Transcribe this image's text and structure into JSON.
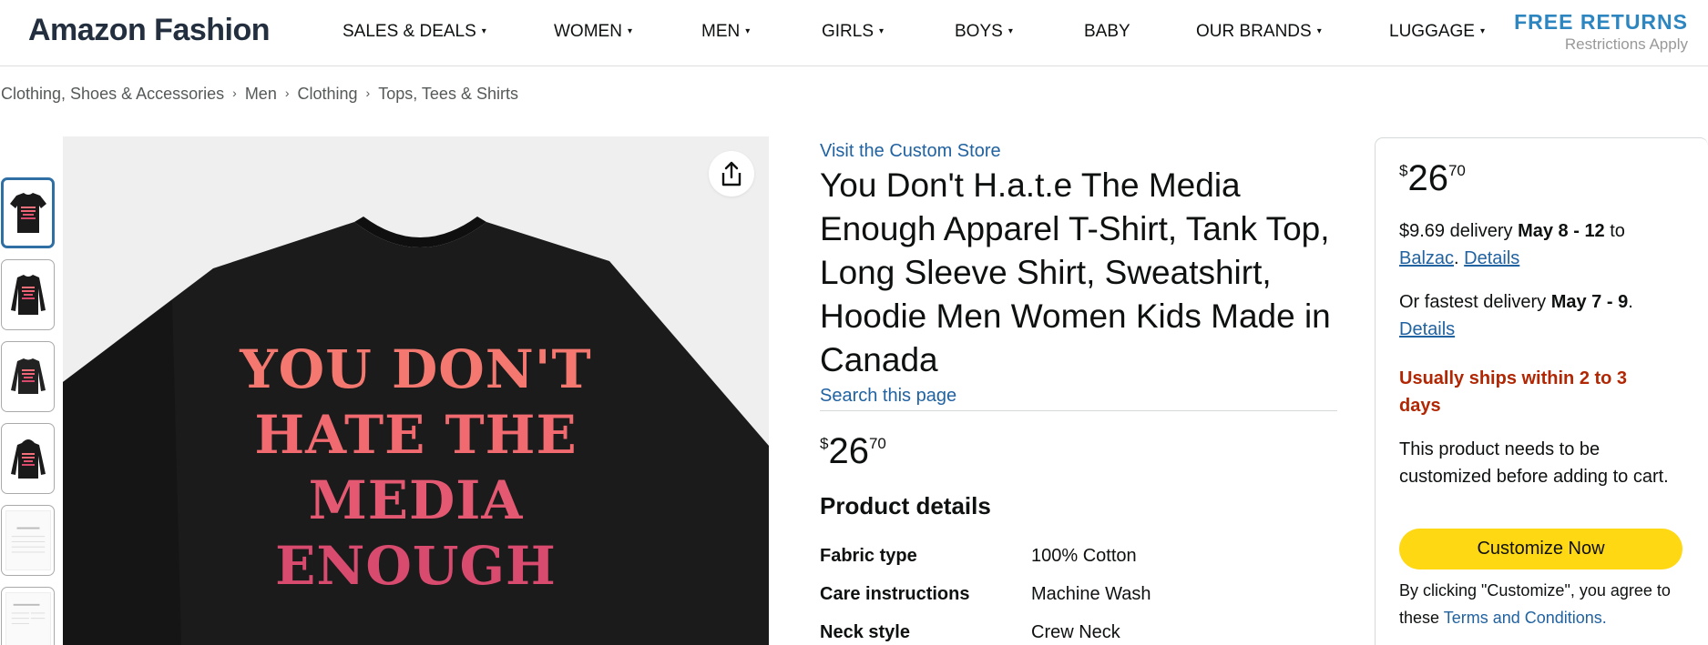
{
  "header": {
    "logo": "Amazon Fashion",
    "nav": [
      {
        "label": "SALES & DEALS",
        "has_menu": true
      },
      {
        "label": "WOMEN",
        "has_menu": true
      },
      {
        "label": "MEN",
        "has_menu": true
      },
      {
        "label": "GIRLS",
        "has_menu": true
      },
      {
        "label": "BOYS",
        "has_menu": true
      },
      {
        "label": "BABY",
        "has_menu": false
      },
      {
        "label": "OUR BRANDS",
        "has_menu": true
      },
      {
        "label": "LUGGAGE",
        "has_menu": true
      }
    ],
    "caret": "▾",
    "promo_title": "FREE RETURNS",
    "promo_sub": "Restrictions Apply"
  },
  "breadcrumb": {
    "items": [
      "Clothing, Shoes & Accessories",
      "Men",
      "Clothing",
      "Tops, Tees & Shirts"
    ],
    "separator": "›"
  },
  "gallery": {
    "thumbnails": [
      {
        "kind": "tshirt",
        "active": true
      },
      {
        "kind": "longsleeve",
        "active": false
      },
      {
        "kind": "sweatshirt",
        "active": false
      },
      {
        "kind": "hoodie",
        "active": false
      },
      {
        "kind": "size-chart",
        "active": false
      },
      {
        "kind": "size-chart",
        "active": false
      }
    ],
    "shirt_print": [
      "YOU DON'T",
      "HATE THE",
      "MEDIA",
      "ENOUGH"
    ],
    "share_icon": "share-icon"
  },
  "product": {
    "store_link": "Visit the Custom Store",
    "title": "You Don't H.a.t.e The Media Enough Apparel T-Shirt, Tank Top, Long Sleeve Shirt, Sweatshirt, Hoodie Men Women Kids Made in Canada",
    "search_link": "Search this page",
    "price": {
      "symbol": "$",
      "whole": "26",
      "fraction": "70"
    },
    "details_heading": "Product details",
    "details": [
      {
        "key": "Fabric type",
        "value": "100% Cotton"
      },
      {
        "key": "Care instructions",
        "value": "Machine Wash"
      },
      {
        "key": "Neck style",
        "value": "Crew Neck"
      }
    ]
  },
  "buybox": {
    "price": {
      "symbol": "$",
      "whole": "26",
      "fraction": "70"
    },
    "delivery_prefix": "$9.69 delivery ",
    "delivery_dates": "May 8 - 12",
    "delivery_to": " to",
    "location": "Balzac",
    "location_suffix": ". ",
    "details_link": "Details",
    "fastest_prefix": "Or fastest delivery ",
    "fastest_dates": "May 7 - 9",
    "fastest_suffix": ".",
    "fastest_details_link": "Details",
    "ships_notice": "Usually ships within 2 to 3 days",
    "customize_notice": "This product needs to be customized before adding to cart.",
    "customize_button": "Customize Now",
    "terms_prefix": "By clicking \"Customize\", you agree to these ",
    "terms_link": "Terms and Conditions."
  },
  "colors": {
    "link": "#2162a1",
    "button": "#ffd814",
    "warning": "#b12704",
    "active_thumb_border": "#2f6fa3"
  }
}
